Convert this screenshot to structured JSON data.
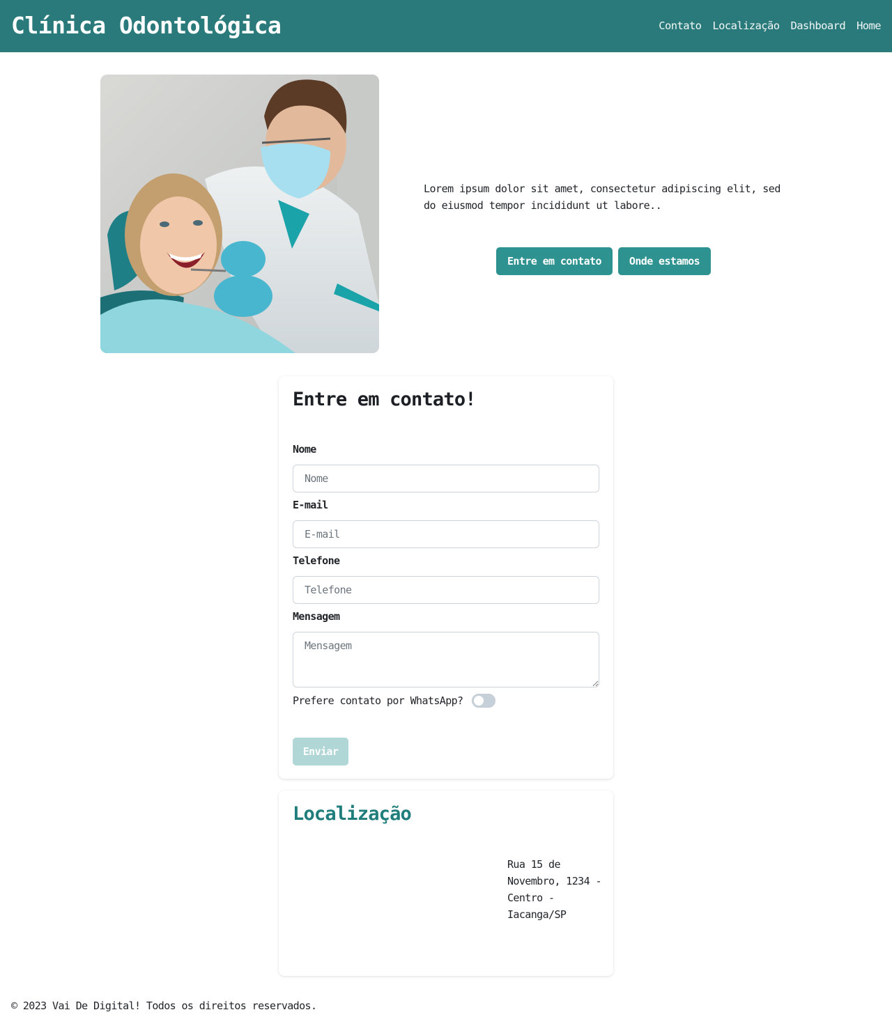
{
  "navbar": {
    "brand": "Clínica Odontológica",
    "links": [
      "Contato",
      "Localização",
      "Dashboard",
      "Home"
    ]
  },
  "hero": {
    "image_alt": "Dentista atendendo paciente sorrindo",
    "text": "Lorem ipsum dolor sit amet, consectetur adipiscing elit, sed do eiusmod tempor incididunt ut labore..",
    "buttons": [
      "Entre em contato",
      "Onde estamos"
    ]
  },
  "contact_form": {
    "title": "Entre em contato!",
    "fields": {
      "name": {
        "label": "Nome",
        "placeholder": "Nome",
        "value": ""
      },
      "email": {
        "label": "E-mail",
        "placeholder": "E-mail",
        "value": ""
      },
      "phone": {
        "label": "Telefone",
        "placeholder": "Telefone",
        "value": ""
      },
      "message": {
        "label": "Mensagem",
        "placeholder": "Mensagem",
        "value": ""
      }
    },
    "whatsapp_toggle": {
      "label": "Prefere contato por WhatsApp?",
      "checked": false
    },
    "submit": "Enviar"
  },
  "location": {
    "title": "Localização",
    "address": "Rua 15 de Novembro, 1234 - Centro - Iacanga/SP"
  },
  "footer": {
    "text": "© 2023 Vai De Digital! Todos os direitos reservados."
  },
  "colors": {
    "navbar": "#2b7a7b",
    "button": "#2e9291",
    "button_disabled": "#b0d6d6",
    "location_title": "#1f7d7c"
  }
}
